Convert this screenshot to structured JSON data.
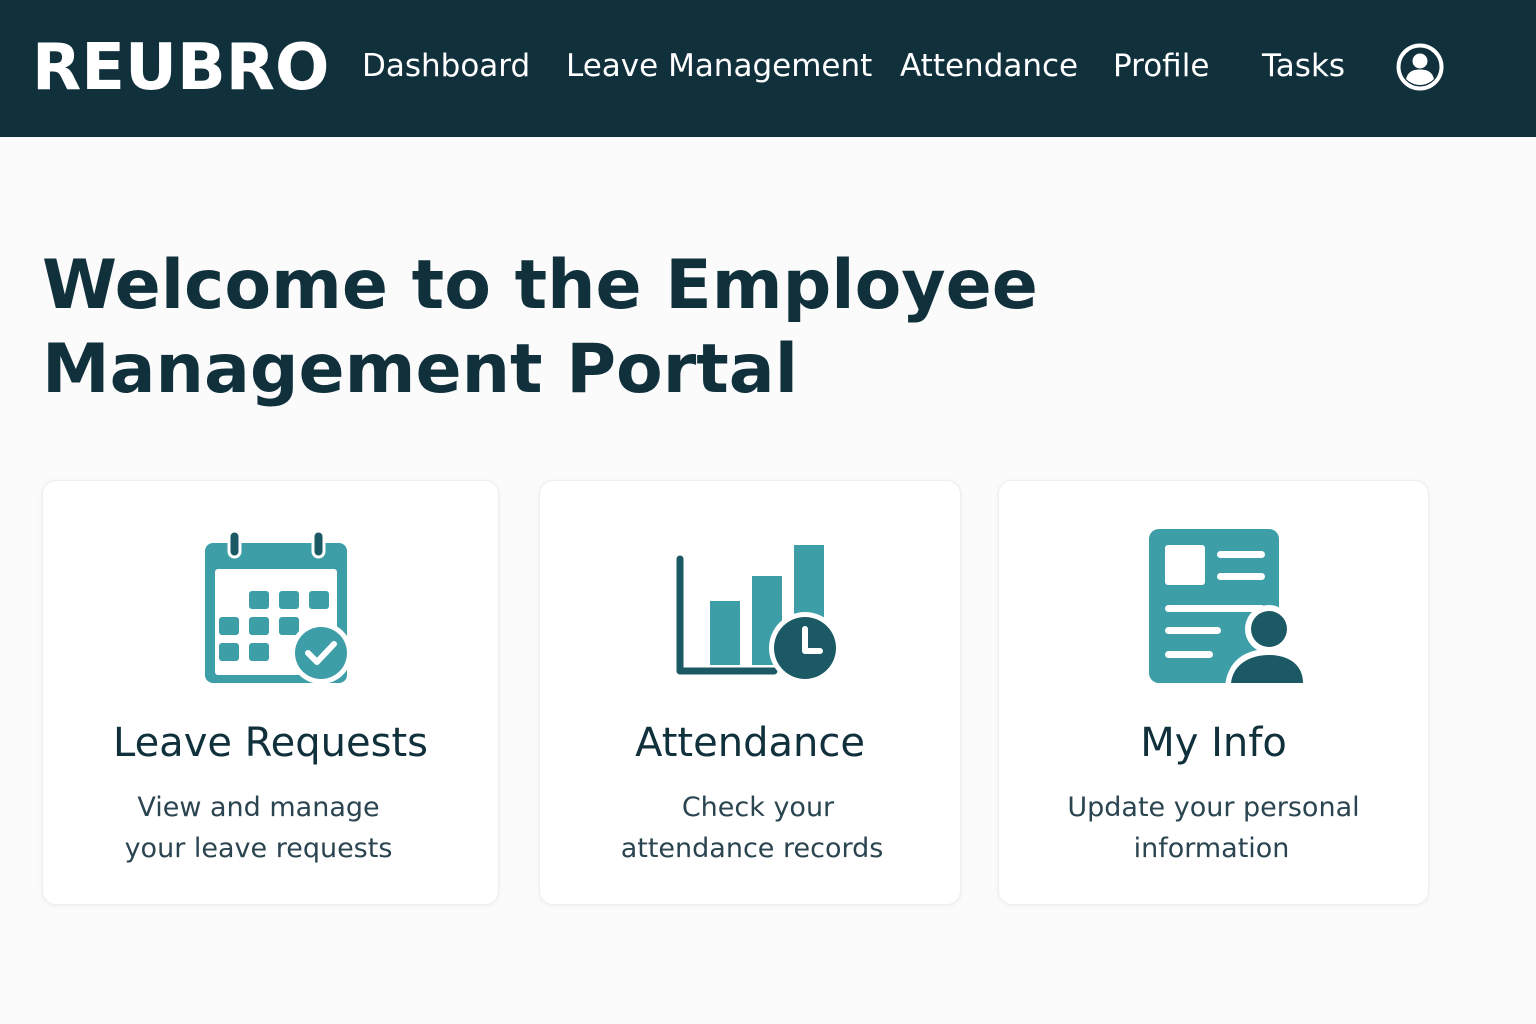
{
  "brand": {
    "name": "REUBRO"
  },
  "nav": {
    "items": [
      {
        "label": "Dashboard"
      },
      {
        "label": "Leave Management"
      },
      {
        "label": "Attendance"
      },
      {
        "label": "Profile"
      },
      {
        "label": "Tasks"
      }
    ],
    "avatar_icon": "user-circle-icon"
  },
  "main": {
    "title_line1": "Welcome to the Employee",
    "title_line2": "Management Portal"
  },
  "cards": [
    {
      "title": "Leave Requests",
      "desc_line1": "View and manage",
      "desc_line2": "your leave requests",
      "icon": "calendar-check-icon"
    },
    {
      "title": "Attendance",
      "desc_line1": "Check your",
      "desc_line2": "attendance records",
      "icon": "chart-clock-icon"
    },
    {
      "title": "My Info",
      "desc_line1": "Update your personal",
      "desc_line2": "information",
      "icon": "id-card-user-icon"
    }
  ],
  "colors": {
    "nav_background": "#10303c",
    "accent_teal": "#3d9ea8",
    "accent_dark": "#1b5a64"
  }
}
